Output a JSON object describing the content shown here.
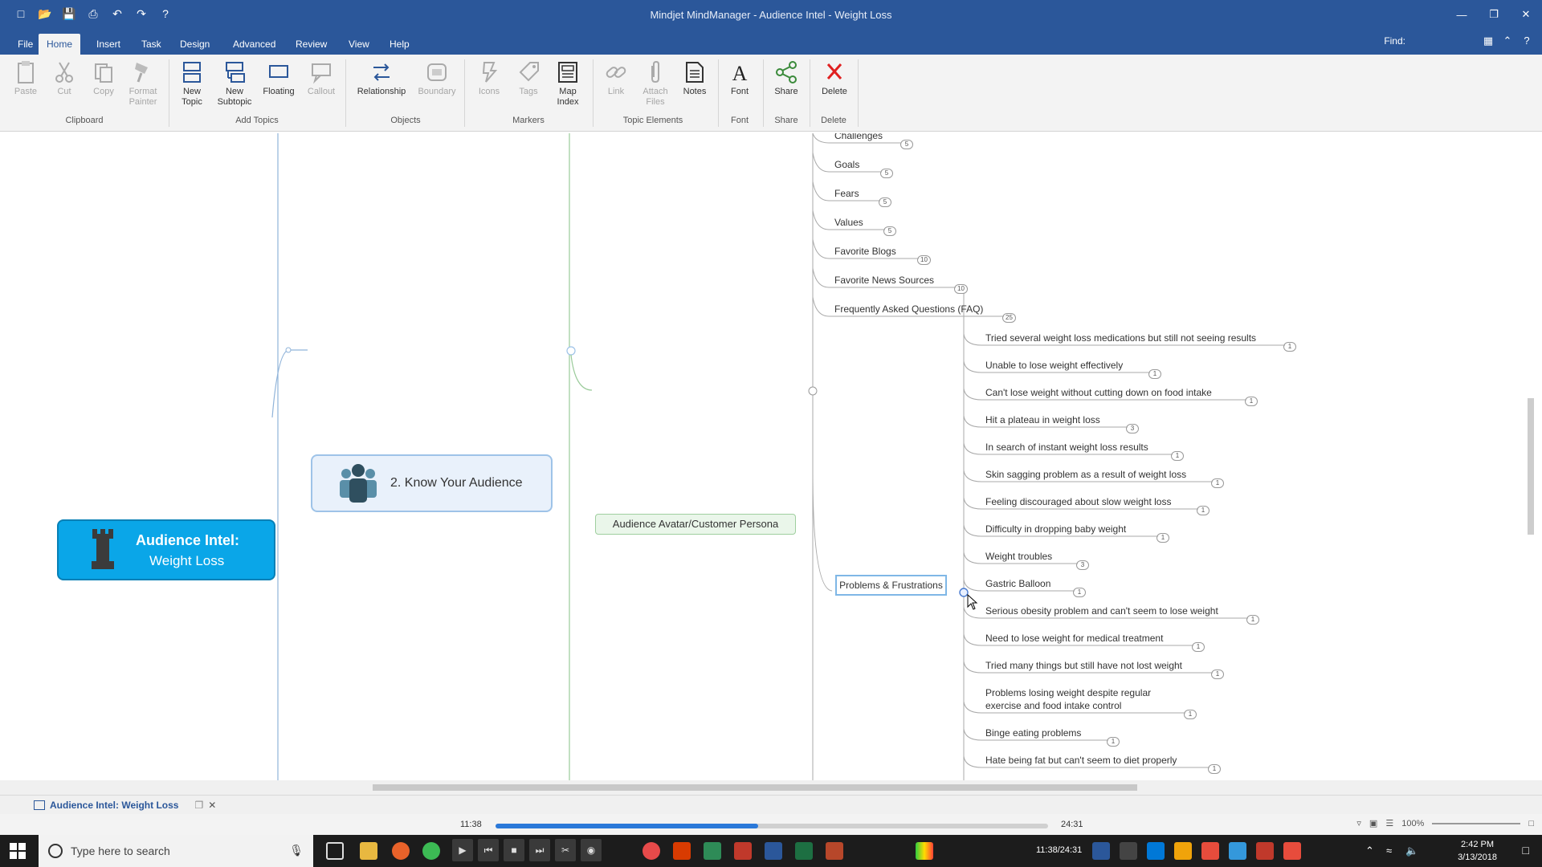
{
  "window": {
    "title": "Mindjet MindManager - Audience Intel - Weight Loss",
    "find_label": "Find:"
  },
  "ribbon_tabs": [
    "File",
    "Home",
    "Insert",
    "Task",
    "Design",
    "Advanced",
    "Review",
    "View",
    "Help"
  ],
  "ribbon": {
    "paste": "Paste",
    "cut": "Cut",
    "copy": "Copy",
    "format_painter_1": "Format",
    "format_painter_2": "Painter",
    "new_topic_1": "New",
    "new_topic_2": "Topic",
    "new_subtopic_1": "New",
    "new_subtopic_2": "Subtopic",
    "floating": "Floating",
    "callout": "Callout",
    "relationship": "Relationship",
    "boundary": "Boundary",
    "icons": "Icons",
    "tags": "Tags",
    "map_index_1": "Map",
    "map_index_2": "Index",
    "link": "Link",
    "attach_files_1": "Attach",
    "attach_files_2": "Files",
    "notes": "Notes",
    "font": "Font",
    "share": "Share",
    "delete": "Delete",
    "groups": {
      "clipboard": "Clipboard",
      "add_topics": "Add Topics",
      "objects": "Objects",
      "markers": "Markers",
      "topic_elements": "Topic Elements",
      "font": "Font",
      "share": "Share",
      "delete": "Delete"
    }
  },
  "map": {
    "central_line1": "Audience Intel:",
    "central_line2": "Weight Loss",
    "topic2": "2. Know Your Audience",
    "persona": "Audience Avatar/Customer Persona",
    "persona_children": [
      {
        "label": "Challenges",
        "badge": "5"
      },
      {
        "label": "Goals",
        "badge": "5"
      },
      {
        "label": "Fears",
        "badge": "5"
      },
      {
        "label": "Values",
        "badge": "5"
      },
      {
        "label": "Favorite Blogs",
        "badge": "10"
      },
      {
        "label": "Favorite News Sources",
        "badge": "10"
      },
      {
        "label": "Frequently Asked Questions (FAQ)",
        "badge": "25"
      }
    ],
    "problems": "Problems & Frustrations",
    "problem_children": [
      {
        "label": "Tried several weight loss medications but still not seeing results",
        "badge": "1"
      },
      {
        "label": "Unable to lose weight effectively",
        "badge": "1"
      },
      {
        "label": "Can't lose weight without cutting down on food intake",
        "badge": "1"
      },
      {
        "label": "Hit a plateau in weight loss",
        "badge": "3"
      },
      {
        "label": "In search of instant weight loss results",
        "badge": "1"
      },
      {
        "label": "Skin sagging problem as a result of weight loss",
        "badge": "1"
      },
      {
        "label": "Feeling discouraged about slow weight loss",
        "badge": "1"
      },
      {
        "label": "Difficulty in dropping baby weight",
        "badge": "1"
      },
      {
        "label": "Weight troubles",
        "badge": "3"
      },
      {
        "label": "Gastric Balloon",
        "badge": "1"
      },
      {
        "label": "Serious obesity problem and can't seem to lose weight",
        "badge": "1"
      },
      {
        "label": "Need to lose weight for medical treatment",
        "badge": "1"
      },
      {
        "label": "Tried many things but still have not lost weight",
        "badge": "1"
      },
      {
        "label": "Problems losing weight despite regular",
        "label2": "exercise and food intake control",
        "badge": "1"
      },
      {
        "label": "Binge eating problems",
        "badge": "1"
      },
      {
        "label": "Hate being fat but can't seem to diet properly",
        "badge": "1"
      }
    ]
  },
  "doc_tab": "Audience Intel: Weight Loss",
  "player": {
    "elapsed": "11:38",
    "total": "24:31",
    "progress": 0.475,
    "combined": "11:38/24:31"
  },
  "status": {
    "zoom": "100%"
  },
  "taskbar": {
    "search_placeholder": "Type here to search",
    "time": "2:42 PM",
    "date": "3/13/2018"
  },
  "colors": {
    "accent": "#2b579a",
    "central": "#0aa6e8",
    "progress": "#2b79d9"
  }
}
